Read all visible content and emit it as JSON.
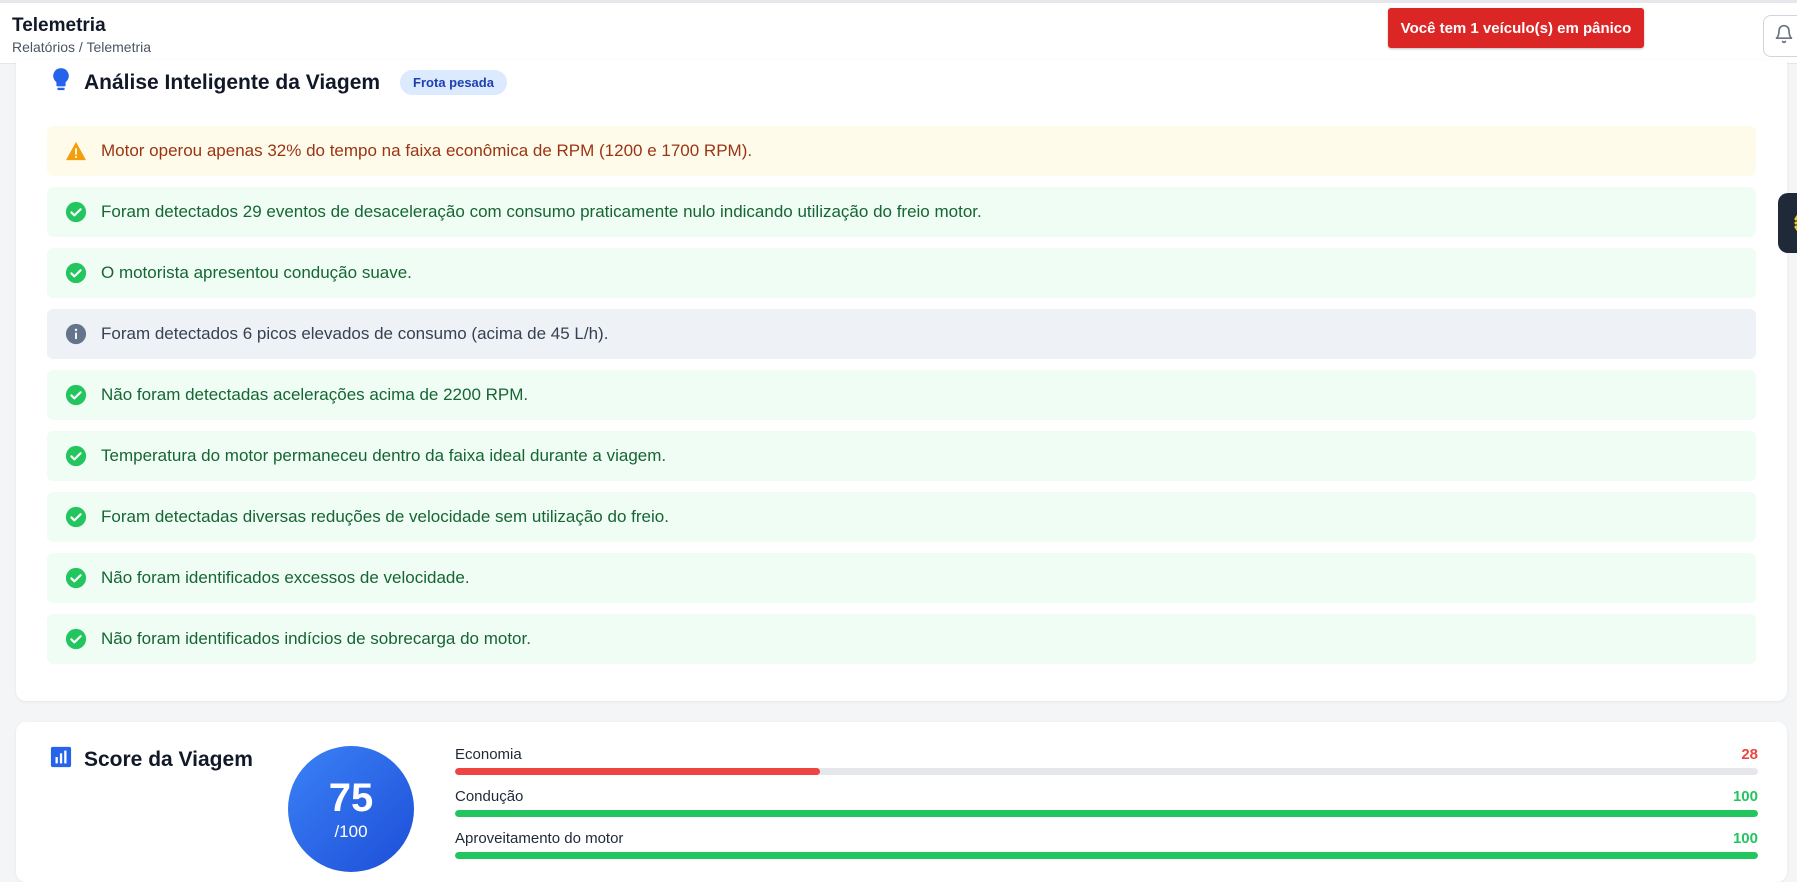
{
  "header": {
    "title": "Telemetria",
    "breadcrumb": "Relatórios / Telemetria",
    "panic_alert": "Você tem 1 veículo(s) em pânico",
    "icons": [
      "bell-icon"
    ]
  },
  "analysis": {
    "title": "Análise Inteligente da Viagem",
    "badge": "Frota pesada",
    "icon": "lightbulb-icon",
    "items": [
      {
        "type": "warning",
        "icon": "warning-triangle-icon",
        "text": "Motor operou apenas 32% do tempo na faixa econômica de RPM (1200 e 1700 RPM)."
      },
      {
        "type": "success",
        "icon": "check-circle-icon",
        "text": "Foram detectados 29 eventos de desaceleração com consumo praticamente nulo indicando utilização do freio motor."
      },
      {
        "type": "success",
        "icon": "check-circle-icon",
        "text": "O motorista apresentou condução suave."
      },
      {
        "type": "info",
        "icon": "info-circle-icon",
        "text": "Foram detectados 6 picos elevados de consumo (acima de 45 L/h)."
      },
      {
        "type": "success",
        "icon": "check-circle-icon",
        "text": "Não foram detectadas acelerações acima de 2200 RPM."
      },
      {
        "type": "success",
        "icon": "check-circle-icon",
        "text": "Temperatura do motor permaneceu dentro da faixa ideal durante a viagem."
      },
      {
        "type": "success",
        "icon": "check-circle-icon",
        "text": "Foram detectadas diversas reduções de velocidade sem utilização do freio."
      },
      {
        "type": "success",
        "icon": "check-circle-icon",
        "text": "Não foram identificados excessos de velocidade."
      },
      {
        "type": "success",
        "icon": "check-circle-icon",
        "text": "Não foram identificados indícios de sobrecarga do motor."
      }
    ]
  },
  "score": {
    "title": "Score da Viagem",
    "icon": "bar-chart-icon",
    "value": "75",
    "max_label": "/100",
    "metrics": [
      {
        "label": "Economia",
        "value": "28",
        "percent": 28,
        "color": "#ef4444"
      },
      {
        "label": "Condução",
        "value": "100",
        "percent": 100,
        "color": "#22c55e"
      },
      {
        "label": "Aproveitamento do motor",
        "value": "100",
        "percent": 100,
        "color": "#22c55e"
      }
    ]
  },
  "colors": {
    "warning": "#f59e0b",
    "success": "#22c55e",
    "info": "#64748b",
    "danger": "#dc2626",
    "accent": "#2563eb"
  }
}
